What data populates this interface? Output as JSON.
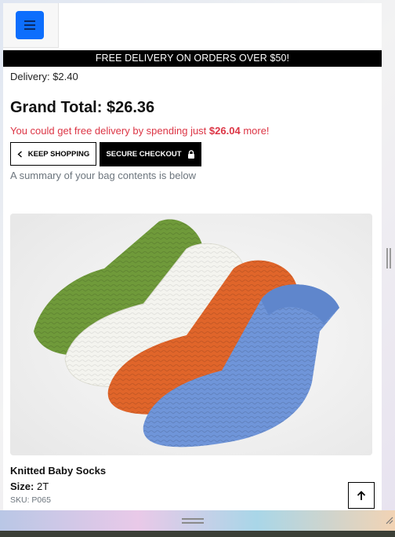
{
  "banner": {
    "text": "FREE DELIVERY ON ORDERS OVER $50!"
  },
  "summary_block": {
    "delivery_label": "Delivery:",
    "delivery_value": "$2.40",
    "grand_total_label": "Grand Total:",
    "grand_total_value": "$26.36",
    "free_delivery_prefix": "You could get free delivery by spending just",
    "free_delivery_amount": "$26.04",
    "free_delivery_suffix": "more!",
    "bag_note": "A summary of your bag contents is below"
  },
  "buttons": {
    "keep_shopping": "KEEP SHOPPING",
    "secure_checkout": "SECURE CHECKOUT"
  },
  "product": {
    "name": "Knitted Baby Socks",
    "size_label": "Size:",
    "size_value": "2T",
    "sku": "SKU: P065",
    "image_alt": "Knitted baby socks in green, white, orange and blue"
  },
  "icons": {
    "menu": "hamburger-menu-icon",
    "keep_shopping": "chevron-left-icon",
    "checkout": "lock-icon",
    "back_to_top": "arrow-up-icon"
  },
  "colors": {
    "menu_button": "#0d6efd",
    "banner_bg": "#000000",
    "free_delivery_text": "#dc3545",
    "muted_text": "#6c757d",
    "sock_green": "#6f9a3a",
    "sock_white": "#f4f4ef",
    "sock_orange": "#e0652a",
    "sock_blue": "#6f95d9"
  }
}
